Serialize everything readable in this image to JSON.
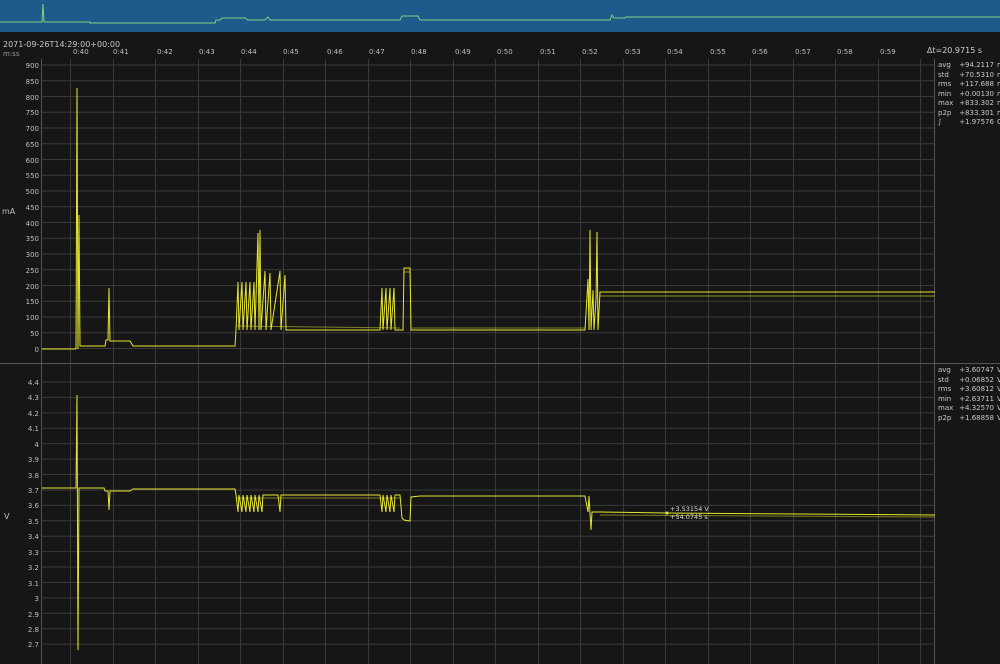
{
  "header": {
    "datetime": "2071-09-26T14:29:00+00:00",
    "axis_units": "m:ss",
    "delta_time": "Δt=20.9715 s",
    "time_ticks": [
      "0:40",
      "0:41",
      "0:42",
      "0:43",
      "0:44",
      "0:45",
      "0:46",
      "0:47",
      "0:48",
      "0:49",
      "0:50",
      "0:51",
      "0:52",
      "0:53",
      "0:54",
      "0:55",
      "0:56",
      "0:57",
      "0:58",
      "0:59"
    ]
  },
  "current_panel": {
    "unit": "mA",
    "y_ticks": [
      "900",
      "850",
      "800",
      "750",
      "700",
      "650",
      "600",
      "550",
      "500",
      "450",
      "400",
      "350",
      "300",
      "250",
      "200",
      "150",
      "100",
      "50",
      "0"
    ],
    "stats": [
      {
        "name": "avg",
        "value": "+94.2117",
        "unit": "mA"
      },
      {
        "name": "std",
        "value": "+70.5310",
        "unit": "mA"
      },
      {
        "name": "rms",
        "value": "+117.688",
        "unit": "mA"
      },
      {
        "name": "min",
        "value": "+0.00130",
        "unit": "mA"
      },
      {
        "name": "max",
        "value": "+833.302",
        "unit": "mA"
      },
      {
        "name": "p2p",
        "value": "+833.301",
        "unit": "mA"
      },
      {
        "name": "∫",
        "value": "+1.97576",
        "unit": "C"
      }
    ]
  },
  "voltage_panel": {
    "unit": "V",
    "y_ticks": [
      "4.4",
      "4.3",
      "4.2",
      "4.1",
      "4",
      "3.9",
      "3.8",
      "3.7",
      "3.6",
      "3.5",
      "3.4",
      "3.3",
      "3.2",
      "3.1",
      "3",
      "2.9",
      "2.8",
      "2.7"
    ],
    "stats": [
      {
        "name": "avg",
        "value": "+3.60747",
        "unit": "V"
      },
      {
        "name": "std",
        "value": "+0.06852",
        "unit": "V"
      },
      {
        "name": "rms",
        "value": "+3.60812",
        "unit": "V"
      },
      {
        "name": "min",
        "value": "+2.63711",
        "unit": "V"
      },
      {
        "name": "max",
        "value": "+4.32570",
        "unit": "V"
      },
      {
        "name": "p2p",
        "value": "+1.68858",
        "unit": "V"
      }
    ],
    "marker_value": "+3.53154 V",
    "marker_time": "+54.0745 s"
  },
  "colors": {
    "trace": "#e6e62e",
    "overview_bg": "#1f5a8a",
    "overview_trace": "#7fd37f",
    "grid": "#3a3a3a",
    "background": "#161616"
  }
}
